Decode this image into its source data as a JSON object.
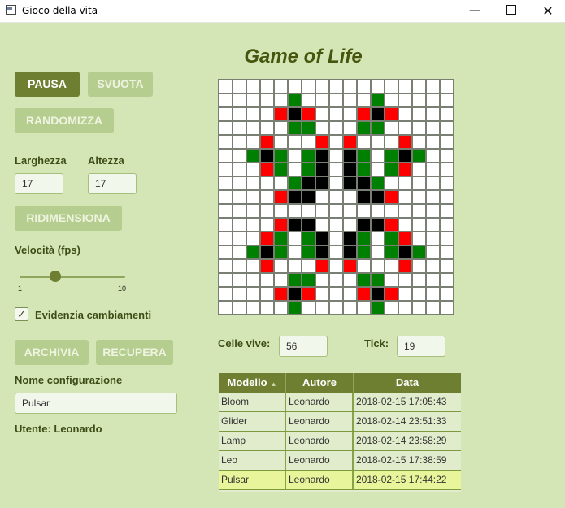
{
  "window": {
    "title": "Gioco della vita",
    "min_icon": "minimize-icon",
    "max_icon": "maximize-icon",
    "close_icon": "close-icon"
  },
  "controls": {
    "pause_label": "PAUSA",
    "clear_label": "SVUOTA",
    "randomize_label": "RANDOMIZZA",
    "width_label": "Larghezza",
    "width_value": "17",
    "height_label": "Altezza",
    "height_value": "17",
    "resize_label": "RIDIMENSIONA",
    "speed_label": "Velocità (fps)",
    "speed_min": "1",
    "speed_max": "10",
    "speed_value": 4,
    "highlight_label": "Evidenzia cambiamenti",
    "highlight_checked": true,
    "archive_label": "ARCHIVIA",
    "retrieve_label": "RECUPERA",
    "config_name_label": "Nome configurazione",
    "config_name_value": "Pulsar",
    "user_label": "Utente: Leonardo"
  },
  "game": {
    "title": "Game of Life",
    "grid_rows": [
      "00000000000000000",
      "00000G00000G00000",
      "0000RBR000RBR0000",
      "00000GG000GG00000",
      "000R000R0R000R000",
      "00GBG0GB0BG0GBG00",
      "000RG0GB0BG0GR000",
      "00000GBB0BBG00000",
      "0000RBB000BBR0000",
      "00000000000000000",
      "0000RBB000BBR0000",
      "000RG0GB0BG0GR000",
      "00GBG0GB0BG0GBG00",
      "000R000R0R000R000",
      "00000GG000GG00000",
      "0000RBR000RBR0000",
      "00000G00000G00000"
    ],
    "cell_colors": {
      "0": "#ffffff",
      "B": "#000000",
      "G": "#008000",
      "R": "#ff0000"
    },
    "live_cells_label": "Celle vive:",
    "live_cells_value": "56",
    "tick_label": "Tick:",
    "tick_value": "19"
  },
  "table": {
    "columns": [
      "Modello",
      "Autore",
      "Data"
    ],
    "sort_icon": "sort-ascending-icon",
    "rows": [
      {
        "model": "Bloom",
        "author": "Leonardo",
        "date": "2018-02-15 17:05:43"
      },
      {
        "model": "Glider",
        "author": "Leonardo",
        "date": "2018-02-14 23:51:33"
      },
      {
        "model": "Lamp",
        "author": "Leonardo",
        "date": "2018-02-14 23:58:29"
      },
      {
        "model": "Leo",
        "author": "Leonardo",
        "date": "2018-02-15 17:38:59"
      },
      {
        "model": "Pulsar",
        "author": "Leonardo",
        "date": "2018-02-15 17:44:22"
      }
    ],
    "selected_row": 4
  }
}
